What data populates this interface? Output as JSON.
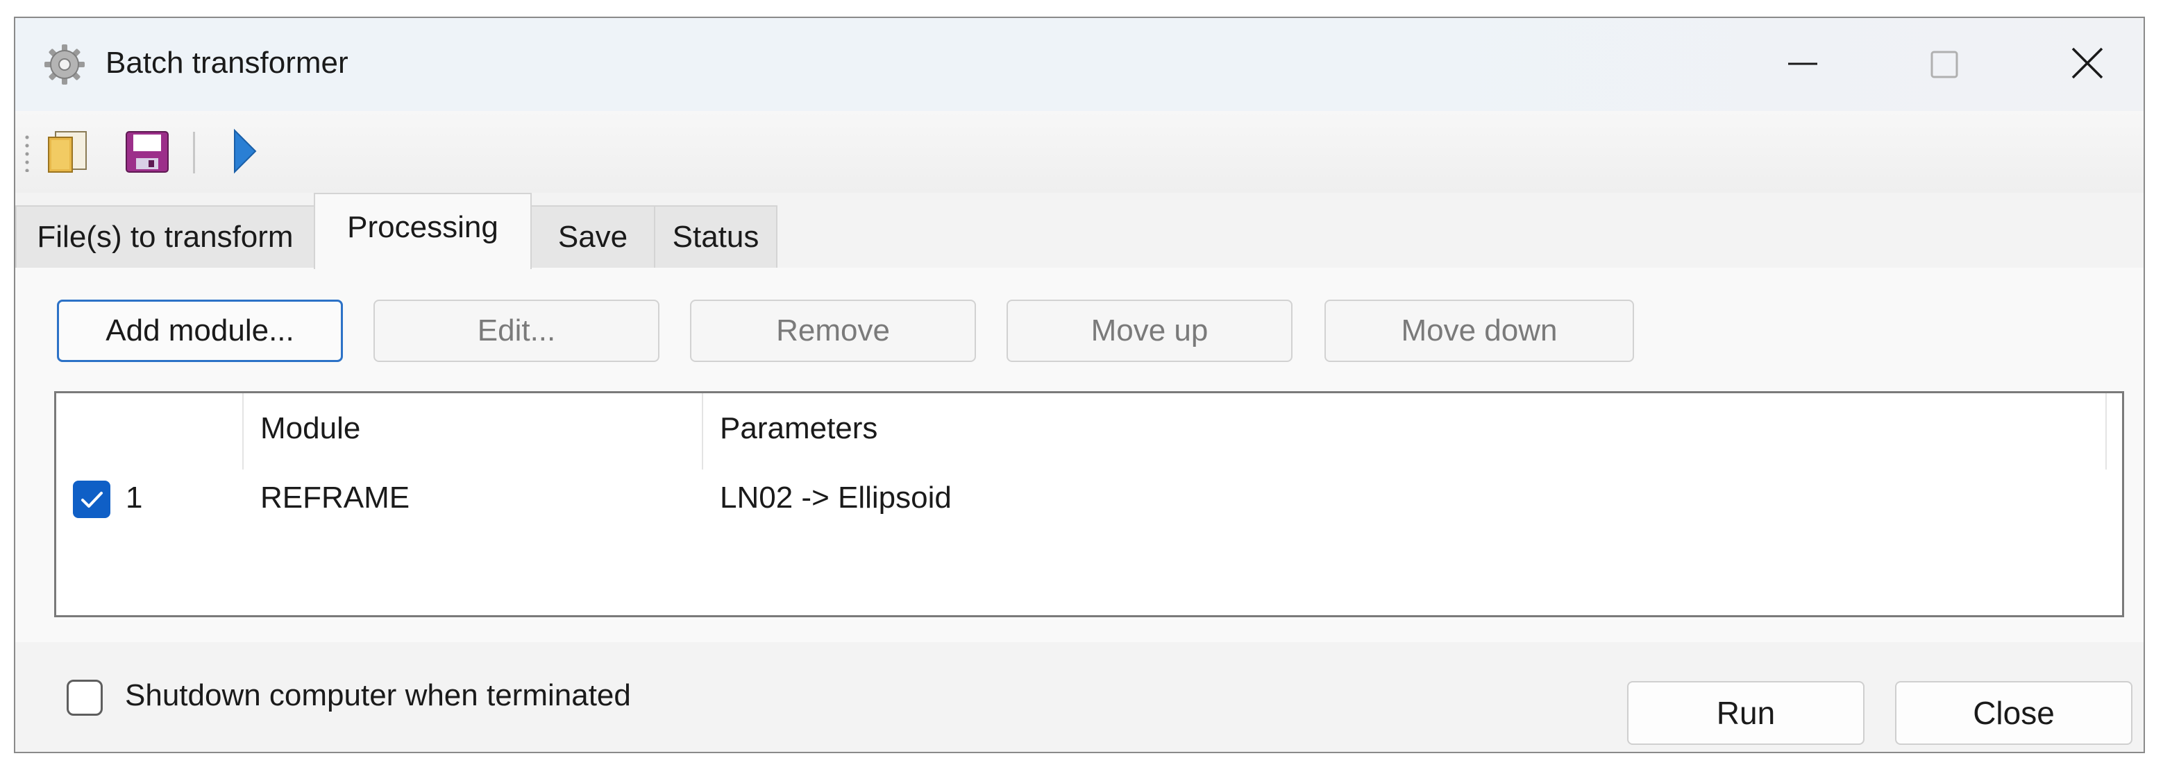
{
  "window": {
    "title": "Batch transformer",
    "icon": "gear-icon",
    "controls": [
      "minimize-icon",
      "maximize-icon",
      "close-icon"
    ]
  },
  "toolbar": {
    "items": [
      {
        "name": "open-files-button",
        "icon": "open-folder-icon"
      },
      {
        "name": "save-button",
        "icon": "floppy-disk-icon"
      },
      {
        "name": "run-button",
        "icon": "play-icon"
      }
    ]
  },
  "tabs": {
    "items": [
      "File(s) to transform",
      "Processing",
      "Save",
      "Status"
    ],
    "selected": "Processing"
  },
  "actions": {
    "add": "Add module...",
    "edit": "Edit...",
    "remove": "Remove",
    "move_up": "Move up",
    "move_down": "Move down"
  },
  "modules_list": {
    "columns": [
      "",
      "Module",
      "Parameters"
    ],
    "rows": [
      {
        "checked": true,
        "index": "1",
        "module": "REFRAME",
        "parameters": "LN02 -> Ellipsoid"
      }
    ]
  },
  "footer": {
    "shutdown_label": "Shutdown computer when terminated",
    "shutdown_checked": false,
    "run_label": "Run",
    "close_label": "Close"
  },
  "colors": {
    "accent": "#0f5fc6",
    "focus_border": "#2c72c7",
    "titlebar": "#eef3f8"
  }
}
